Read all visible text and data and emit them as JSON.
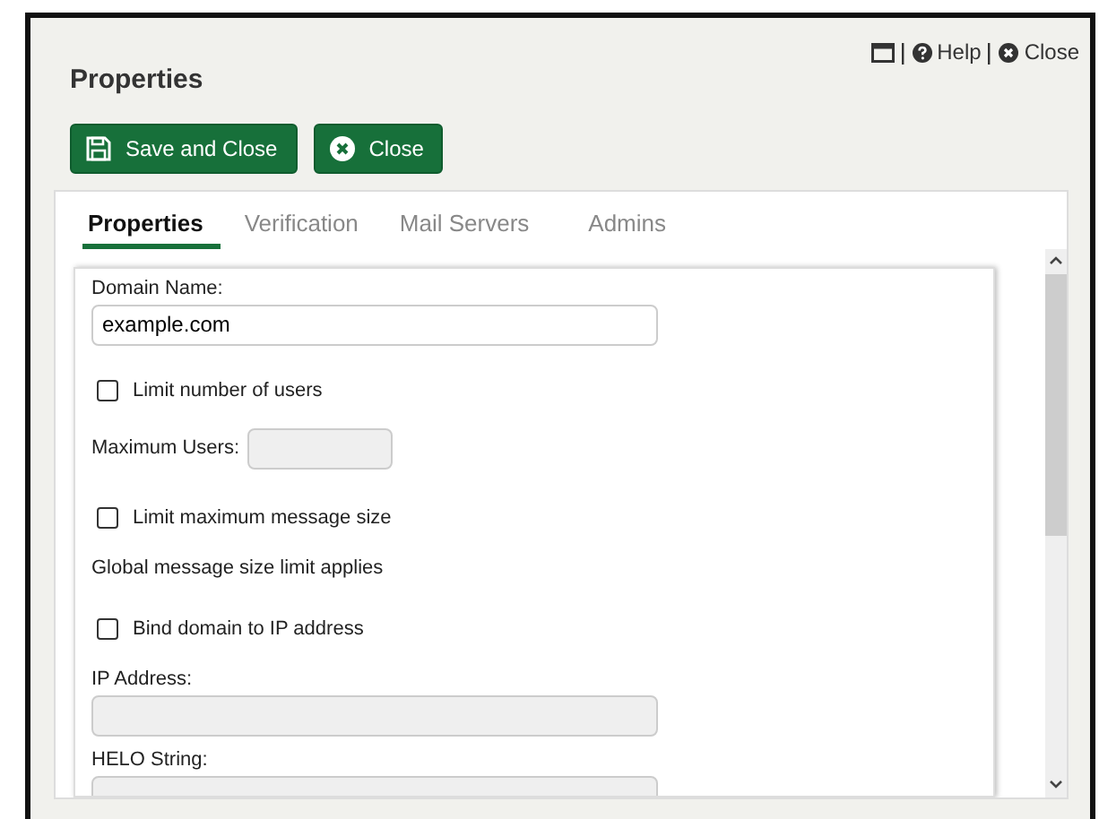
{
  "header_links": [
    {
      "kind": "window"
    },
    {
      "kind": "help",
      "label": "Help"
    },
    {
      "kind": "close",
      "label": "Close"
    }
  ],
  "title": "Properties",
  "buttons": [
    {
      "kind": "save",
      "label": "Save and Close"
    },
    {
      "kind": "close",
      "label": "Close"
    }
  ],
  "tabs": [
    {
      "label": "Properties",
      "selected": true
    },
    {
      "label": "Verification",
      "selected": false
    },
    {
      "label": "Mail Servers",
      "selected": false
    },
    {
      "label": "Admins",
      "selected": false
    }
  ],
  "form": [
    {
      "kind": "field",
      "label": "Domain Name:",
      "value": "example.com",
      "disabled": false
    },
    {
      "kind": "checkbox",
      "label": "Limit number of users",
      "checked": false
    },
    {
      "kind": "inline_field",
      "label": "Maximum Users:",
      "disabled": true
    },
    {
      "kind": "checkbox",
      "label": "Limit maximum message size",
      "checked": false
    },
    {
      "kind": "note",
      "label": "Global message size limit applies"
    },
    {
      "kind": "checkbox",
      "label": "Bind domain to IP address",
      "checked": false
    },
    {
      "kind": "field",
      "label": "IP Address:",
      "disabled": true
    },
    {
      "kind": "field",
      "label": "HELO String:",
      "disabled": true
    }
  ]
}
